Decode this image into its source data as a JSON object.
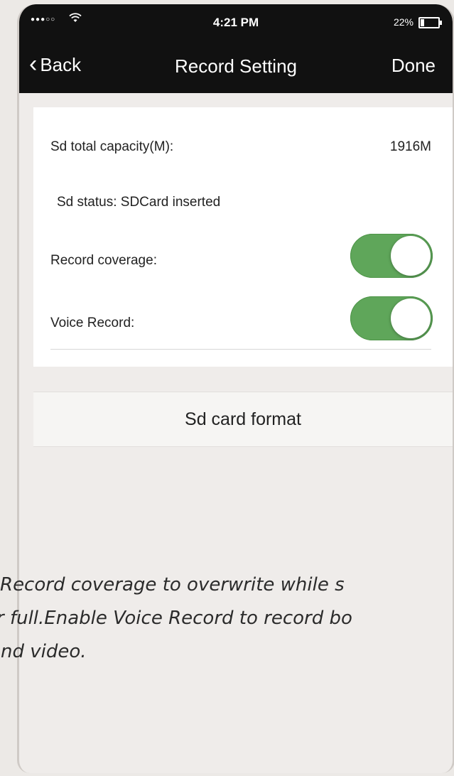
{
  "status_bar": {
    "signal": "●●●○○",
    "time": "4:21 PM",
    "battery_percent": "22%",
    "battery_level": 0.22
  },
  "nav": {
    "back_label": "Back",
    "title": "Record Setting",
    "done_label": "Done"
  },
  "settings": {
    "capacity_label": "Sd total capacity(M):",
    "capacity_value": "1916M",
    "status_text": "Sd status: SDCard inserted",
    "record_coverage_label": "Record coverage:",
    "record_coverage_on": true,
    "voice_record_label": "Voice Record:",
    "voice_record_on": true
  },
  "format_button_label": "Sd card format",
  "caption": {
    "line1": "Record coverage to overwrite while s",
    "line2": "r full.Enable Voice Record to record bo",
    "line3": "nd video."
  },
  "colors": {
    "toggle_on": "#5fa65a",
    "navbar": "#111111"
  }
}
